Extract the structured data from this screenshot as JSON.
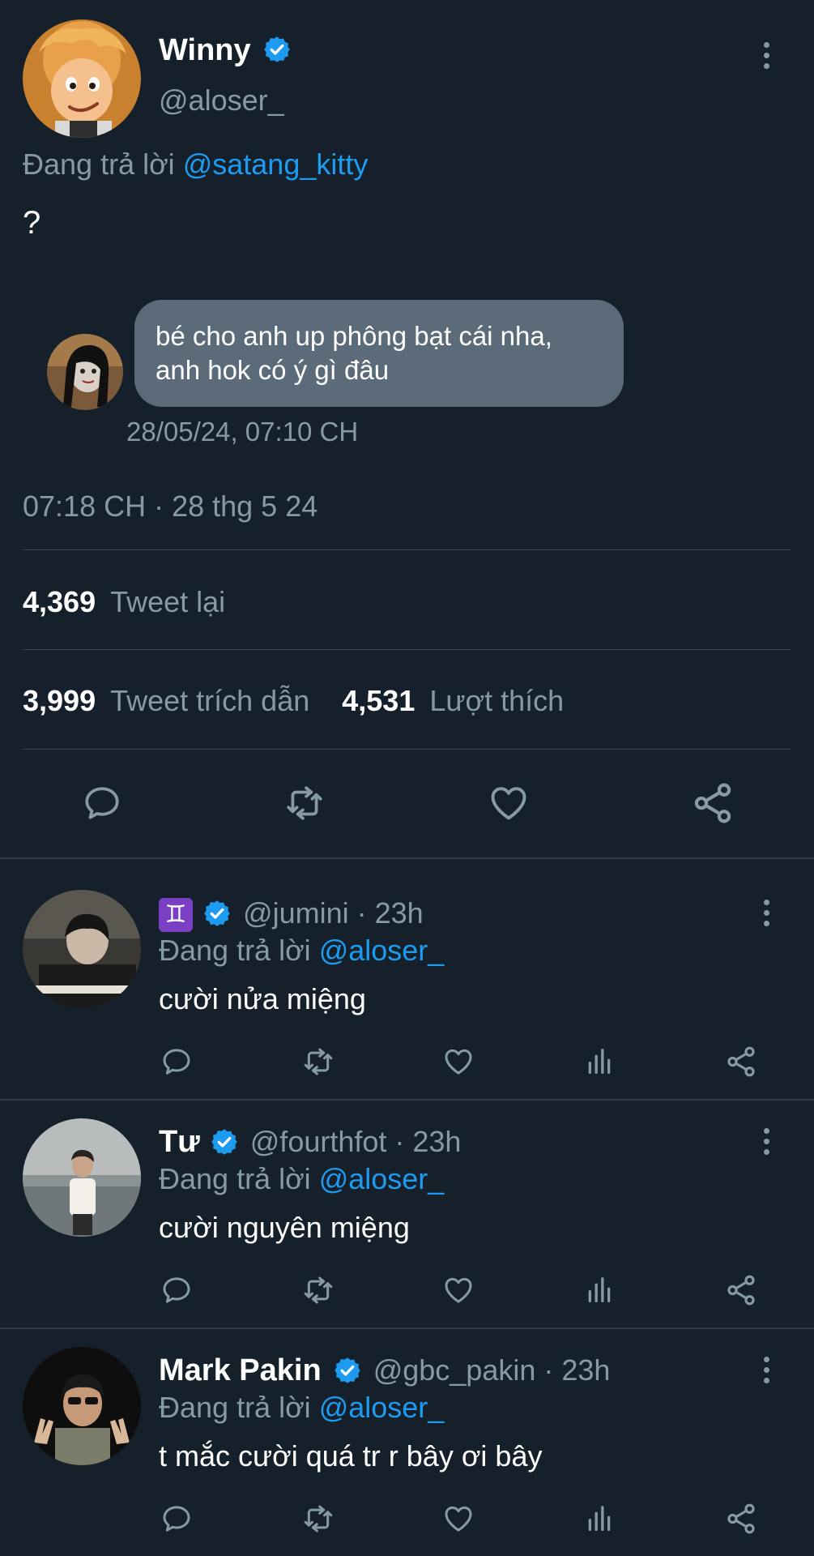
{
  "tweet": {
    "author_name": "Winny",
    "author_handle": "@aloser_",
    "reply_prefix": "Đang trả lời",
    "reply_to": "@satang_kitty",
    "text": "?",
    "dm_message_line1": "bé cho anh up phông bạt cái nha,",
    "dm_message_line2": "anh hok có ý gì đâu",
    "dm_timestamp": "28/05/24, 07:10 CH",
    "timestamp": "07:18 CH · 28 thg 5 24",
    "retweets_count": "4,369",
    "retweets_label": "Tweet lại",
    "quotes_count": "3,999",
    "quotes_label": "Tweet trích dẫn",
    "likes_count": "4,531",
    "likes_label": "Lượt thích"
  },
  "replies": [
    {
      "name": "♊",
      "handle_time": "@jumini · 23h",
      "reply_prefix": "Đang trả lời",
      "reply_to": "@aloser_",
      "text": "cười nửa miệng"
    },
    {
      "name": "Tư",
      "handle_time": "@fourthfot · 23h",
      "reply_prefix": "Đang trả lời",
      "reply_to": "@aloser_",
      "text": "cười nguyên miệng"
    },
    {
      "name": "Mark Pakin",
      "handle_time": "@gbc_pakin · 23h",
      "reply_prefix": "Đang trả lời",
      "reply_to": "@aloser_",
      "text": "t mắc cười quá tr r bây ơi bây"
    }
  ],
  "icons": {
    "reply": "reply-icon",
    "retweet": "retweet-icon",
    "like": "heart-icon",
    "share": "share-icon",
    "analytics": "analytics-icon",
    "more": "more-icon",
    "verified": "verified-badge-icon"
  },
  "colors": {
    "background": "#15202b",
    "accent": "#1d9bf0",
    "muted": "#8899a6",
    "dm_bubble": "#5b6b7a"
  }
}
